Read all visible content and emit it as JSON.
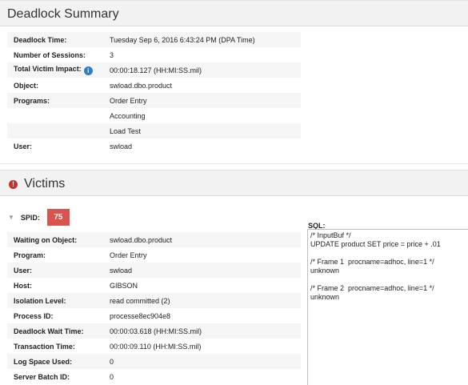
{
  "summary": {
    "title": "Deadlock Summary",
    "rows": [
      {
        "label": "Deadlock Time:",
        "value": "Tuesday Sep 6, 2016 6:43:24 PM (DPA Time)"
      },
      {
        "label": "Number of Sessions:",
        "value": "3"
      },
      {
        "label": "Total Victim Impact:",
        "value": "00:00:18.127 (HH:MI:SS.mil)"
      },
      {
        "label": "Object:",
        "value": "swload.dbo.product"
      },
      {
        "label": "Programs:",
        "value": "Order Entry"
      },
      {
        "label": "",
        "value": "Accounting"
      },
      {
        "label": "",
        "value": "Load Test"
      },
      {
        "label": "User:",
        "value": "swload"
      }
    ],
    "info_icon": "i"
  },
  "victims": {
    "title": "Victims",
    "alert_icon": "!",
    "spid_label": "SPID:",
    "spid_value": "75",
    "rows": [
      {
        "label": "Waiting on Object:",
        "value": "swload.dbo.product"
      },
      {
        "label": "Program:",
        "value": "Order Entry"
      },
      {
        "label": "User:",
        "value": "swload"
      },
      {
        "label": "Host:",
        "value": "GIBSON"
      },
      {
        "label": "Isolation Level:",
        "value": "read committed (2)"
      },
      {
        "label": "Process ID:",
        "value": "processe8ec904e8"
      },
      {
        "label": "Deadlock Wait Time:",
        "value": "00:00:03.618 (HH:MI:SS.mil)"
      },
      {
        "label": "Transaction Time:",
        "value": "00:00:09.110 (HH:MI:SS.mil)"
      },
      {
        "label": "Log Space Used:",
        "value": "0"
      },
      {
        "label": "Server Batch ID:",
        "value": "0"
      }
    ],
    "sql_label": "SQL:",
    "sql_text": "/* InputBuf */\nUPDATE product SET price = price + .01\n\n/* Frame 1  procname=adhoc, line=1 */\nunknown\n\n/* Frame 2  procname=adhoc, line=1 */\nunknown"
  },
  "colors": {
    "spid_badge": "#d9534f",
    "info_icon": "#2d7ec9",
    "alert_icon": "#c9302c"
  }
}
